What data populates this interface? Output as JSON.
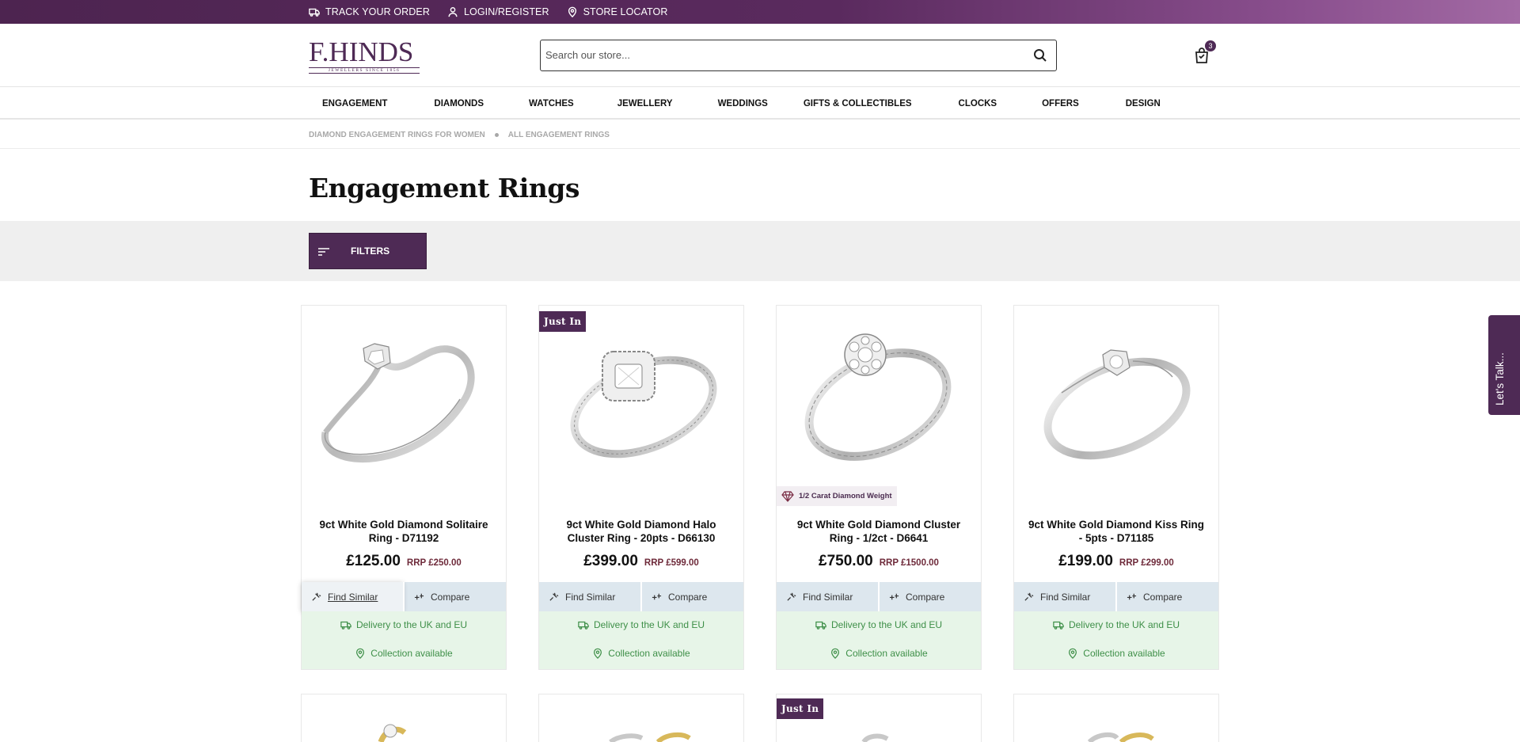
{
  "topbar": {
    "items": [
      {
        "label": "TRACK YOUR ORDER",
        "icon": "truck-icon"
      },
      {
        "label": "LOGIN/REGISTER",
        "icon": "user-icon"
      },
      {
        "label": "STORE LOCATOR",
        "icon": "map-pin-icon"
      }
    ]
  },
  "header": {
    "logo_text": "F.HINDS",
    "logo_tagline": "JEWELLERS SINCE 1856",
    "search_placeholder": "Search our store...",
    "cart_count": "3"
  },
  "nav": {
    "items": [
      "ENGAGEMENT",
      "DIAMONDS",
      "WATCHES",
      "JEWELLERY",
      "WEDDINGS",
      "GIFTS & COLLECTIBLES",
      "CLOCKS",
      "OFFERS",
      "DESIGN"
    ]
  },
  "breadcrumb": [
    "DIAMOND ENGAGEMENT RINGS FOR WOMEN",
    "ALL ENGAGEMENT RINGS"
  ],
  "page_title": "Engagement Rings",
  "filters_label": "FILTERS",
  "product_actions": {
    "find_similar": "Find Similar",
    "compare": "Compare"
  },
  "delivery": {
    "delivery": "Delivery to the UK and EU",
    "collection": "Collection available"
  },
  "products": [
    {
      "title": "9ct White Gold Diamond Solitaire Ring - D71192",
      "price": "£125.00",
      "rrp": "RRP £250.00",
      "badge": "",
      "tag": ""
    },
    {
      "title": "9ct White Gold Diamond Halo Cluster Ring - 20pts - D66130",
      "price": "£399.00",
      "rrp": "RRP £599.00",
      "badge": "Just In",
      "tag": ""
    },
    {
      "title": "9ct White Gold Diamond Cluster Ring - 1/2ct - D6641",
      "price": "£750.00",
      "rrp": "RRP £1500.00",
      "badge": "",
      "tag": "1/2 Carat Diamond Weight"
    },
    {
      "title": "9ct White Gold Diamond Kiss Ring - 5pts - D71185",
      "price": "£199.00",
      "rrp": "RRP £299.00",
      "badge": "",
      "tag": ""
    }
  ],
  "row2_badge": "Just In",
  "chat_tab": "Let's Talk...",
  "colors": {
    "brand_purple": "#4e2a55",
    "action_bar": "#dde7ee",
    "delivery_bg": "#e7f5e8",
    "delivery_text": "#3e8f48",
    "rrp": "#6e2a3a"
  }
}
